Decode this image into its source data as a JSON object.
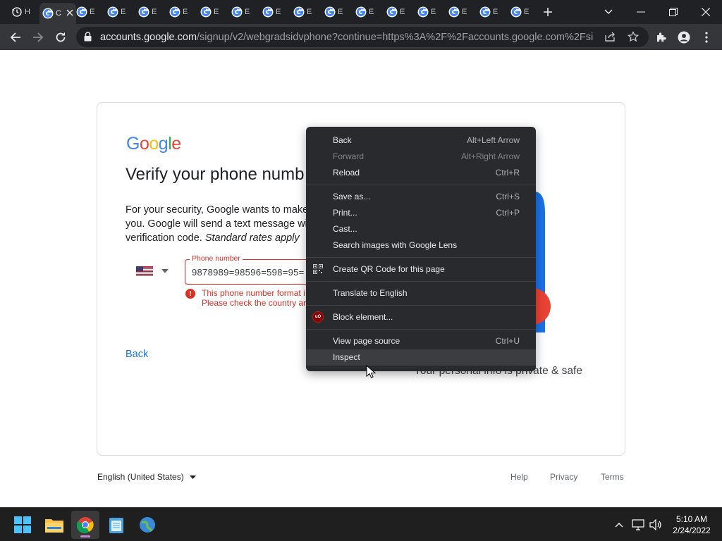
{
  "browser": {
    "tabs": [
      {
        "letter": "H",
        "favicon": "history-icon"
      },
      {
        "letter": "C",
        "favicon": "google-icon",
        "active": true
      },
      {
        "letter": "E",
        "favicon": "google-icon"
      },
      {
        "letter": "E",
        "favicon": "google-icon"
      },
      {
        "letter": "E",
        "favicon": "google-icon"
      },
      {
        "letter": "E",
        "favicon": "google-icon"
      },
      {
        "letter": "E",
        "favicon": "google-icon"
      },
      {
        "letter": "E",
        "favicon": "google-icon"
      },
      {
        "letter": "E",
        "favicon": "google-icon"
      },
      {
        "letter": "E",
        "favicon": "google-icon"
      },
      {
        "letter": "E",
        "favicon": "google-icon"
      },
      {
        "letter": "E",
        "favicon": "google-icon"
      },
      {
        "letter": "E",
        "favicon": "google-icon"
      },
      {
        "letter": "E",
        "favicon": "google-icon"
      },
      {
        "letter": "E",
        "favicon": "google-icon"
      },
      {
        "letter": "E",
        "favicon": "google-icon"
      },
      {
        "letter": "E",
        "favicon": "google-icon"
      }
    ],
    "url_host": "accounts.google.com",
    "url_path": "/signup/v2/webgradsidvphone?continue=https%3A%2F%2Faccounts.google.com%2Fsigni..."
  },
  "page": {
    "logo": "Google",
    "logo_colors": [
      "#4285F4",
      "#EA4335",
      "#FBBC05",
      "#4285F4",
      "#34A853",
      "#EA4335"
    ],
    "title": "Verify your phone numb",
    "desc_line1": "For your security, Google wants to make s",
    "desc_line2": "you. Google will send a text message with",
    "desc_line3_plain": "verification code. ",
    "desc_line3_italic": "Standard rates apply",
    "phone_label": "Phone number",
    "phone_value": "9878989=98596=598=95=",
    "error_line1": "This phone number format i",
    "error_line2": "Please check the country ar",
    "back_label": "Back",
    "safe_text": "Your personal info is private & safe"
  },
  "footer": {
    "language": "English (United States)",
    "help": "Help",
    "privacy": "Privacy",
    "terms": "Terms"
  },
  "context_menu": {
    "groups": [
      [
        {
          "label": "Back",
          "shortcut": "Alt+Left Arrow"
        },
        {
          "label": "Forward",
          "shortcut": "Alt+Right Arrow",
          "disabled": true
        },
        {
          "label": "Reload",
          "shortcut": "Ctrl+R"
        }
      ],
      [
        {
          "label": "Save as...",
          "shortcut": "Ctrl+S"
        },
        {
          "label": "Print...",
          "shortcut": "Ctrl+P"
        },
        {
          "label": "Cast...",
          "shortcut": ""
        },
        {
          "label": "Search images with Google Lens",
          "shortcut": ""
        }
      ],
      [
        {
          "label": "Create QR Code for this page",
          "shortcut": "",
          "icon": "qr-code-icon"
        }
      ],
      [
        {
          "label": "Translate to English",
          "shortcut": ""
        }
      ],
      [
        {
          "label": "Block element...",
          "shortcut": "",
          "icon": "ublock-origin-icon",
          "icon_text": "uO"
        }
      ],
      [
        {
          "label": "View page source",
          "shortcut": "Ctrl+U"
        },
        {
          "label": "Inspect",
          "shortcut": "",
          "hover": true
        }
      ]
    ]
  },
  "taskbar": {
    "apps": [
      "windows-start-icon",
      "file-explorer-icon",
      "chrome-icon",
      "notepad-icon",
      "globe-app-icon"
    ],
    "time": "5:10 AM",
    "date": "2/24/2022"
  }
}
